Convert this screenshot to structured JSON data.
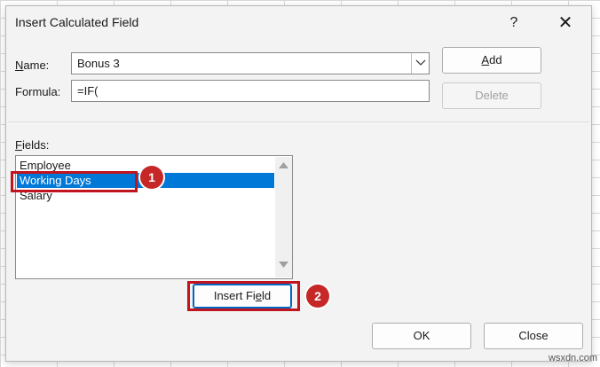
{
  "dialog": {
    "title": "Insert Calculated Field",
    "help_label": "?",
    "close_label": "✕"
  },
  "name_field": {
    "label_accel": "N",
    "label_rest": "ame:",
    "value": "Bonus 3"
  },
  "formula_field": {
    "label_accel": "",
    "label_rest": "Formula:",
    "value": "=IF("
  },
  "buttons": {
    "add_accel": "A",
    "add_rest": "dd",
    "delete": "Delete",
    "insert_field_pre": "Insert Fi",
    "insert_field_accel": "e",
    "insert_field_post": "ld",
    "ok": "OK",
    "close": "Close"
  },
  "fields": {
    "label_accel": "F",
    "label_rest": "ields:",
    "items": [
      "Employee",
      "Working Days",
      "Salary"
    ],
    "selected": "Working Days"
  },
  "annotations": {
    "badge_1": "1",
    "badge_2": "2",
    "highlight_color": "#c0141f",
    "badge_color": "#c62828"
  },
  "watermark": "wsxdn.com",
  "colors": {
    "selection": "#0078d7",
    "dialog_bg": "#f3f3f3"
  }
}
